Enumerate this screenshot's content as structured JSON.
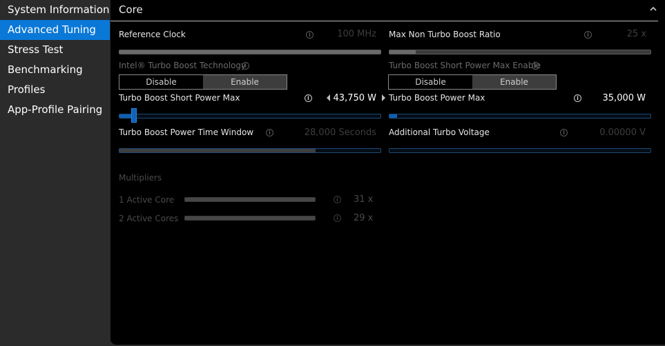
{
  "sidebar": {
    "items": [
      {
        "label": "System Information"
      },
      {
        "label": "Advanced Tuning"
      },
      {
        "label": "Stress Test"
      },
      {
        "label": "Benchmarking"
      },
      {
        "label": "Profiles"
      },
      {
        "label": "App-Profile Pairing"
      }
    ],
    "active_index": 1
  },
  "panel": {
    "title": "Core",
    "collapse_icon": "chevron-up-icon"
  },
  "settings": {
    "reference_clock": {
      "label": "Reference Clock",
      "value": "100 MHz",
      "level": 1.0
    },
    "max_non_turbo": {
      "label": "Max Non Turbo Boost Ratio",
      "value": "25 x",
      "level": 0.1
    },
    "turbo_boost_tech": {
      "label": "Intel® Turbo Boost Technology",
      "disable": "Disable",
      "enable": "Enable",
      "selected": "Enable"
    },
    "short_power_enable": {
      "label": "Turbo Boost Short Power Max Enable",
      "disable": "Disable",
      "enable": "Enable",
      "selected": "Enable"
    },
    "short_power_max": {
      "label": "Turbo Boost Short Power Max",
      "value": "43,750 W",
      "level": 0.055
    },
    "power_max": {
      "label": "Turbo Boost Power Max",
      "value": "35,000 W",
      "level": 0.03
    },
    "time_window": {
      "label": "Turbo Boost Power Time Window",
      "value": "28,000 Seconds",
      "level": 0.75
    },
    "turbo_voltage": {
      "label": "Additional Turbo Voltage",
      "value": "0.00000 V",
      "level": 0.0
    }
  },
  "multipliers": {
    "heading": "Multipliers",
    "rows": [
      {
        "label": "1 Active Core",
        "value": "31 x",
        "level": 1.0
      },
      {
        "label": "2 Active Cores",
        "value": "29 x",
        "level": 1.0
      }
    ]
  },
  "colors": {
    "accent": "#0a78d7",
    "sidebar_bg": "#2b2b2b",
    "panel_bg": "#000000"
  }
}
